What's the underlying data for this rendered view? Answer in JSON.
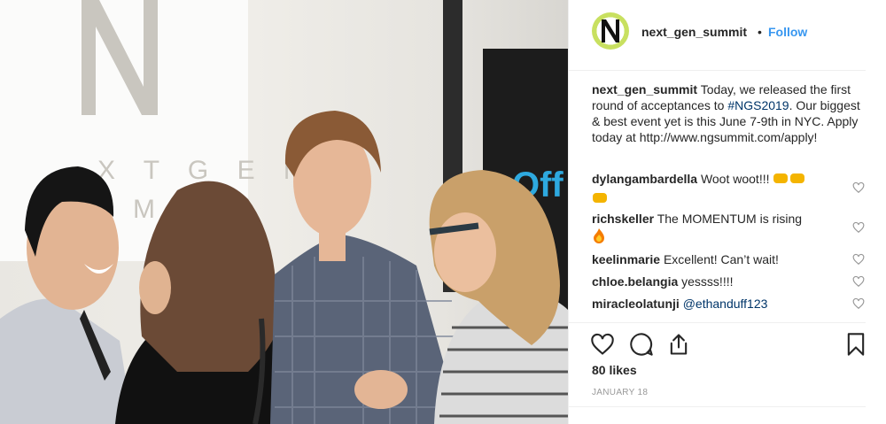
{
  "post": {
    "username": "next_gen_summit",
    "separator": "•",
    "follow_label": "Follow",
    "caption": {
      "username": "next_gen_summit",
      "text_before": "Today, we released the first round of acceptances to",
      "hashtag": "#NGS2019",
      "text_after": ". Our biggest & best event yet is this June 7-9th in NYC. Apply today at http://www.ngsummit.com/apply!"
    },
    "comments": [
      {
        "username": "dylangambardella",
        "text": "Woot woot!!!",
        "emoji": "fist-icon"
      },
      {
        "username": "richskeller",
        "text": "The MOMENTUM is rising",
        "emoji": "fire-icon"
      },
      {
        "username": "keelinmarie",
        "text": "Excellent! Can’t wait!",
        "emoji": ""
      },
      {
        "username": "chloe.belangia",
        "text": "yessss!!!!",
        "emoji": ""
      },
      {
        "username": "miracleolatunji",
        "text": "",
        "mention": "@ethanduff123",
        "emoji": ""
      }
    ],
    "likes": "80 likes",
    "date": "JANUARY 18",
    "icons": {
      "like": "heart-icon",
      "comment": "comment-icon",
      "share": "share-icon",
      "save": "bookmark-icon"
    },
    "brand_color": "#3897f0"
  },
  "photo": {
    "banner_text": "Off",
    "logo_letter_left": "N",
    "logo_row1": "X T G E N",
    "logo_row2": "M M"
  }
}
